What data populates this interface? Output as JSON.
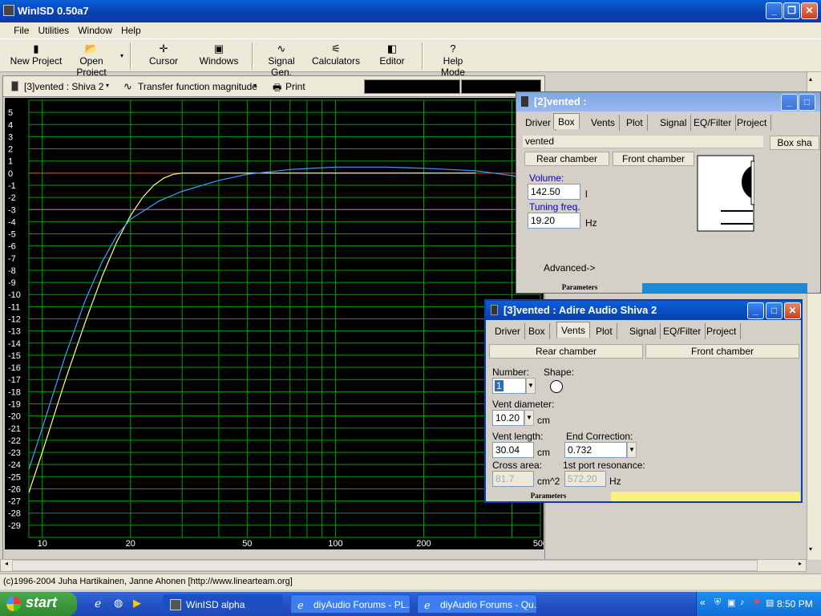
{
  "window": {
    "title": "WinISD 0.50a7"
  },
  "menu": [
    "File",
    "Utilities",
    "Window",
    "Help"
  ],
  "toolbar": [
    {
      "label": "New Project",
      "icon": "new-project-icon",
      "glyph": "▮"
    },
    {
      "label": "Open Project",
      "icon": "open-folder-icon",
      "glyph": "📂"
    },
    {
      "label": "Cursor",
      "icon": "cursor-icon",
      "glyph": "✛"
    },
    {
      "label": "Windows",
      "icon": "windows-icon",
      "glyph": "▣"
    },
    {
      "label": "Signal Gen.",
      "icon": "signal-gen-icon",
      "glyph": "∿"
    },
    {
      "label": "Calculators",
      "icon": "calculator-icon",
      "glyph": "⚟"
    },
    {
      "label": "Editor",
      "icon": "editor-icon",
      "glyph": "◧"
    },
    {
      "label": "Help Mode",
      "icon": "help-icon",
      "glyph": "?"
    }
  ],
  "graph": {
    "project_select": "[3]vented : Shiva 2",
    "plot_select": "Transfer function magnitude",
    "print_label": "Print"
  },
  "chart_data": {
    "type": "line",
    "x_scale": "log",
    "xlim": [
      9,
      500
    ],
    "ylim": [
      -30,
      6
    ],
    "x_tick_labels": [
      "10",
      "20",
      "50",
      "100",
      "200",
      "500"
    ],
    "y_tick_labels": [
      "5",
      "4",
      "3",
      "2",
      "1",
      "0",
      "-1",
      "-2",
      "-3",
      "-4",
      "-5",
      "-6",
      "-7",
      "-8",
      "-9",
      "-10",
      "-11",
      "-12",
      "-13",
      "-14",
      "-15",
      "-16",
      "-17",
      "-18",
      "-19",
      "-20",
      "-21",
      "-22",
      "-23",
      "-24",
      "-25",
      "-26",
      "-27",
      "-28",
      "-29"
    ],
    "grid": true,
    "reference_lines": [
      {
        "y": 0,
        "color": "#ff3030"
      },
      {
        "y": -3,
        "color": "#ff30ff"
      }
    ],
    "series": [
      {
        "color": "#ffff80",
        "x": [
          9,
          10,
          12,
          14,
          16,
          18,
          20,
          22,
          24,
          26,
          28,
          30,
          35,
          40,
          50,
          100,
          200,
          300
        ],
        "y": [
          -26.3,
          -23,
          -17,
          -12.3,
          -8.5,
          -5.6,
          -3.5,
          -2.0,
          -1.0,
          -0.4,
          -0.1,
          0.0,
          0.0,
          0.0,
          0.0,
          0.0,
          0.0,
          0.0
        ]
      },
      {
        "color": "#40a0ff",
        "x": [
          9,
          10,
          12,
          14,
          16,
          18,
          20,
          25,
          30,
          40,
          50,
          70,
          100,
          150,
          200,
          300,
          400,
          500
        ],
        "y": [
          -24.4,
          -21,
          -15,
          -10.5,
          -7.3,
          -5.1,
          -3.8,
          -2.3,
          -1.5,
          -0.6,
          -0.1,
          0.3,
          0.5,
          0.5,
          0.4,
          0.2,
          -0.2,
          -0.8
        ]
      }
    ]
  },
  "panel_box": {
    "title": "[2]vented :",
    "tabs": [
      "Driver",
      "Box",
      "Vents",
      "Plot",
      "Signal",
      "EQ/Filter",
      "Project"
    ],
    "selected_tab": "Box",
    "box_type": "vented",
    "box_shape_btn": "Box sha",
    "rear_btn": "Rear chamber",
    "front_btn": "Front chamber",
    "volume_label": "Volume:",
    "volume_value": "142.50",
    "volume_unit": "l",
    "tuning_label": "Tuning freq.",
    "tuning_value": "19.20",
    "tuning_unit": "Hz",
    "advanced": "Advanced->",
    "status": "Parameters"
  },
  "panel_vents": {
    "title": "[3]vented : Adire Audio Shiva 2",
    "tabs": [
      "Driver",
      "Box",
      "Vents",
      "Plot",
      "Signal",
      "EQ/Filter",
      "Project"
    ],
    "selected_tab": "Vents",
    "rear_btn": "Rear chamber",
    "front_btn": "Front chamber",
    "number_label": "Number:",
    "number_value": "1",
    "shape_label": "Shape:",
    "diameter_label": "Vent diameter:",
    "diameter_value": "10.20",
    "diameter_unit": "cm",
    "length_label": "Vent length:",
    "length_value": "30.04",
    "length_unit": "cm",
    "endcorr_label": "End Correction:",
    "endcorr_value": "0.732",
    "cross_label": "Cross area:",
    "cross_value": "81.7",
    "cross_unit": "cm^2",
    "resonance_label": "1st port resonance:",
    "resonance_value": "572.20",
    "resonance_unit": "Hz",
    "status": "Parameters"
  },
  "statusbar": {
    "text": "(c)1996-2004 Juha Hartikainen, Janne Ahonen [http://www.linearteam.org]"
  },
  "taskbar": {
    "start": "start",
    "items": [
      "WinISD alpha",
      "diyAudio Forums - PL...",
      "diyAudio Forums - Qu..."
    ],
    "clock": "8:50 PM"
  }
}
